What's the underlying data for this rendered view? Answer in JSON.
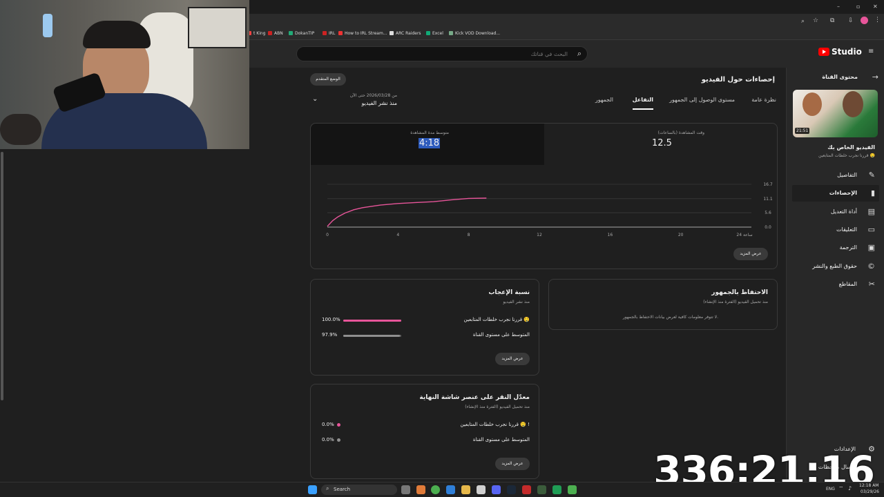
{
  "browser": {
    "bookmarks": [
      {
        "label": "t King",
        "color": "#e44"
      },
      {
        "label": "ABN",
        "color": "#c22"
      },
      {
        "label": "DokanTIP",
        "color": "#2a7"
      },
      {
        "label": "IRL",
        "color": "#c22"
      },
      {
        "label": "How to IRL Stream...",
        "color": "#e33"
      },
      {
        "label": "ARC Raiders",
        "color": "#ddd"
      },
      {
        "label": "Excel",
        "color": "#1a7"
      },
      {
        "label": "Kick VOD Download...",
        "color": "#7a8"
      }
    ],
    "window_controls": [
      "–",
      "▫",
      "✕"
    ]
  },
  "header": {
    "logo_text": "Studio",
    "search_placeholder": "البحث في قناتك"
  },
  "sidebar": {
    "back_label": "محتوى القناة",
    "video_title": "الفيديو الخاص بك",
    "video_subtitle": "قررنا نجرب خلطات المتابعين 🤤",
    "thumb_duration": "21:51",
    "items": [
      {
        "label": "التفاصيل",
        "icon": "pencil-icon",
        "glyph": "✎",
        "active": false
      },
      {
        "label": "الإحصاءات",
        "icon": "analytics-icon",
        "glyph": "▮",
        "active": true
      },
      {
        "label": "أداة التعديل",
        "icon": "editor-icon",
        "glyph": "▤",
        "active": false
      },
      {
        "label": "التعليقات",
        "icon": "comments-icon",
        "glyph": "▭",
        "active": false
      },
      {
        "label": "الترجمة",
        "icon": "subtitles-icon",
        "glyph": "▣",
        "active": false
      },
      {
        "label": "حقوق الطبع والنشر",
        "icon": "copyright-icon",
        "glyph": "©",
        "active": false
      },
      {
        "label": "المقاطع",
        "icon": "scissors-icon",
        "glyph": "✂",
        "active": false
      }
    ],
    "settings_label": "الإعدادات",
    "feedback_label": "إرسال ملاحظات"
  },
  "page": {
    "title": "إحصاءات حول الفيديو",
    "advanced_mode": "الوضع المتقدم",
    "date_range_caption": "من 2026/03/28 حتى الآن",
    "date_range_value": "منذ نشر الفيديو",
    "tabs": [
      {
        "label": "نظرة عامة",
        "active": false
      },
      {
        "label": "مستوى الوصول إلى الجمهور",
        "active": false
      },
      {
        "label": "التفاعل",
        "active": true
      },
      {
        "label": "الجمهور",
        "active": false
      }
    ]
  },
  "metrics": {
    "watch_time_label": "وقت المشاهدة (بالساعات)",
    "watch_time_value": "12.5",
    "avg_duration_label": "متوسط مدة المشاهدة",
    "avg_duration_value": "4:18"
  },
  "chart_data": {
    "type": "line",
    "x_ticks": [
      "0",
      "4",
      "8",
      "12",
      "16",
      "20",
      "24 ساعة"
    ],
    "y_ticks": [
      "0.0",
      "5.6",
      "11.1",
      "16.7"
    ],
    "ylim": [
      0,
      16.7
    ],
    "xlim": [
      0,
      24
    ],
    "series": [
      {
        "color": "#e8559a",
        "x": [
          0,
          0.3,
          0.6,
          1,
          1.5,
          2,
          3,
          4,
          5,
          6,
          7,
          8,
          9
        ],
        "y": [
          0.3,
          2.5,
          4.0,
          5.5,
          6.8,
          7.6,
          8.6,
          9.2,
          9.6,
          9.9,
          10.6,
          11.2,
          11.3
        ]
      }
    ],
    "more_button": "عرض المزيد"
  },
  "retention": {
    "title": "الاحتفاظ بالجمهور",
    "subtitle": "منذ تحميل الفيديو (الفترة منذ الإنشاء)",
    "message": "لا تتوفر معلومات كافية لعرض بيانات الاحتفاظ بالجمهور."
  },
  "likes": {
    "title": "نسبة الإعجاب",
    "subtitle": "منذ نشر الفيديو",
    "rows": [
      {
        "label": "قررنا نجرب خلطات المتابعين 🤤",
        "value": "100.0%",
        "fraction": 1.0,
        "color": "#e8559a"
      },
      {
        "label": "المتوسط على مستوى القناة",
        "value": "97.9%",
        "fraction": 0.979,
        "color": "#909090"
      }
    ],
    "more_button": "عرض المزيد"
  },
  "endscreen": {
    "title": "معدّل النقر على عنصر شاشة النهاية",
    "subtitle": "منذ تحميل الفيديو (الفترة منذ الإنشاء)",
    "rows": [
      {
        "label": "قررنا نجرب خلطات المتابعين 🤤 !",
        "value": "0.0%",
        "color": "#e8559a"
      },
      {
        "label": "المتوسط على مستوى القناة",
        "value": "0.0%",
        "color": "#909090"
      }
    ],
    "more_button": "عرض المزيد"
  },
  "overlay": {
    "timer": "336:21:16"
  },
  "taskbar": {
    "search_label": "Search",
    "lang": "ENG",
    "time": "12:18 AM",
    "date": "03/29/26"
  }
}
